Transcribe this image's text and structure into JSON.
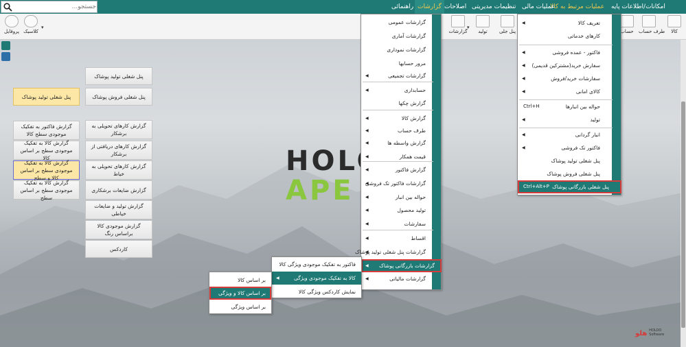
{
  "menubar": {
    "items": [
      "امکانات/اطلاعات پایه",
      "عملیات مرتبط به کالا",
      "عملیات مالی",
      "تنظیمات مدیریتی",
      "اصلاحات",
      "گزارشات",
      "راهنمائی"
    ],
    "search_placeholder": "جستجو..."
  },
  "toolbar": {
    "buttons": [
      "کالا",
      "طرف حساب",
      "حساب",
      "تولید",
      "گزارشات",
      "پنل جلی",
      "کلاسیک",
      "پروفایل"
    ]
  },
  "left_panels": {
    "top_right": [
      "پنل شغلی تولید پوشاک",
      "پنل شغلی فروش پوشاک"
    ],
    "yellow_left": "پنل شغلی تولید پوشاک",
    "right_col": [
      "گزارش کارهای تحویلی به برشکار",
      "گزارش کارهای دریافتی از برشکار",
      "گزارش کارهای تحویلی به خیاط",
      "گزارش ضایعات برشکاری",
      "گزارش تولید و ضایعات خیاطی",
      "گزارش موجودی کالا براساس رنگ",
      "کاردکس"
    ],
    "left_col": [
      "گزارش فاکتور به تفکیک موجودی سطح کالا",
      "گزارش کالا به تفکیک موجودی سطح بر اساس کالا",
      "گزارش کالا به تفکیک موجودی سطح بر اساس کالا و سطح",
      "گزارش کالا به تفکیک موجودی سطح بر اساس سطح"
    ]
  },
  "menu_kala": {
    "items": [
      "تعریف کالا",
      "کارهای خدماتی",
      "فاکتور - عمده فروشی",
      "سفارش خرید(مشترکین قدیمی)",
      "سفارشات خرید/فروش",
      "کالای امانی",
      "حواله بین انبارها",
      "تولید",
      "انبار گردانی",
      "فاکتور تک فروشی",
      "پنل شغلی تولید پوشاک",
      "پنل شغلی فروش پوشاک",
      "پنل شغلی بازرگانی پوشاک"
    ],
    "shortcuts": {
      "haval": "Ctrl+H",
      "bazargani": "Ctrl+Alt+P"
    }
  },
  "menu_reports": {
    "items": [
      "گزارشات عمومی",
      "گزارشات آماری",
      "گزارشات نموداری",
      "مرور حسابها",
      "گزارشات تجمیعی",
      "حسابداری",
      "گزارش چکها",
      "گزارش کالا",
      "طرف حساب",
      "گزارش واسطه ها",
      "قیمت همکار",
      "گزارش فاکتور",
      "گزارشات فاکتور تک فروشی",
      "حواله بین انبار",
      "تولید محصول",
      "سفارشات",
      "اقساط",
      "گزارشات پنل شغلی تولید پوشاک",
      "گزارشات بازرگانی پوشاک",
      "گزارشات مالیاتی"
    ]
  },
  "menu_bazargani": {
    "items": [
      "فاکتور به تفکیک موجودی ویژگی کالا",
      "کالا به تفکیک موجودی ویژگی",
      "نمایش کاردکس ویژگی کالا"
    ]
  },
  "menu_vijegi": {
    "items": [
      "بر اساس کالا",
      "بر اساس کالا و ویژگی",
      "بر اساس ویژگی"
    ]
  },
  "logo": {
    "line1": "HOLO",
    "line2": "APE",
    "brand": "هلو",
    "brand_sub": "HOLOO Software"
  },
  "colors": {
    "teal": "#1f7a75",
    "highlight_red": "#d63a3a",
    "active_menu": "#f2c94c"
  }
}
